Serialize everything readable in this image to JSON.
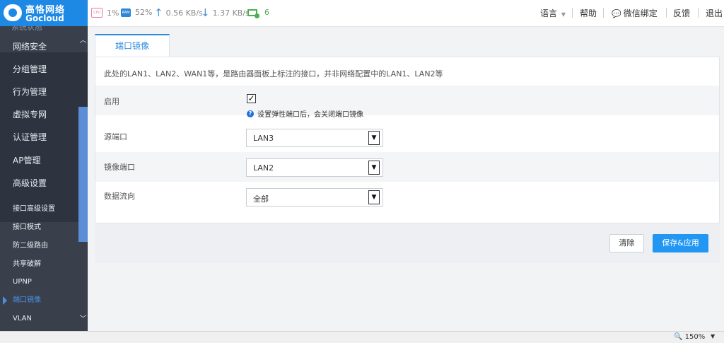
{
  "logo": {
    "cn": "高恪网络",
    "en": "Gocloud"
  },
  "stats": {
    "cpu_chip": "CPU",
    "cpu": "1%",
    "ram_chip": "RAM",
    "ram": "52%",
    "upload": "0.56 KB/s",
    "download": "1.37 KB/s",
    "devices": "6"
  },
  "topnav": {
    "language": "语言",
    "help": "帮助",
    "wechat": "微信绑定",
    "feedback": "反馈",
    "logout": "退出"
  },
  "sidebar": {
    "partial": "系统状态",
    "menu": [
      "网络安全",
      "分组管理",
      "行为管理",
      "虚拟专网",
      "认证管理",
      "AP管理",
      "高级设置"
    ],
    "submenu": [
      "接口高级设置",
      "接口模式",
      "防二级路由",
      "共享破解",
      "UPNP",
      "端口镜像",
      "VLAN"
    ],
    "active_sub": "端口镜像"
  },
  "tab": "端口镜像",
  "notice": "此处的LAN1、LAN2、WAN1等，是路由器面板上标注的接口，并非网络配置中的LAN1、LAN2等",
  "form": {
    "enable_label": "启用",
    "enable_checked": true,
    "hint": "设置弹性端口后，会关闭端口镜像",
    "source_label": "源端口",
    "source_value": "LAN3",
    "mirror_label": "镜像端口",
    "mirror_value": "LAN2",
    "direction_label": "数据流向",
    "direction_value": "全部"
  },
  "buttons": {
    "clear": "清除",
    "save": "保存&应用"
  },
  "statusbar": {
    "zoom": "150%"
  },
  "colors": {
    "accent": "#2196f3",
    "sidebar": "#39404c",
    "logo_bg": "#1e88e5"
  }
}
